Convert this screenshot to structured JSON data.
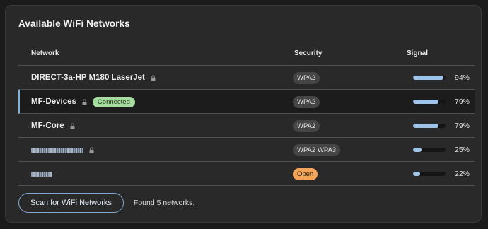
{
  "title": "Available WiFi Networks",
  "columns": {
    "network": "Network",
    "security": "Security",
    "signal": "Signal"
  },
  "networks": [
    {
      "name": "DIRECT-3a-HP M180 LaserJet",
      "locked": true,
      "connected": false,
      "security": [
        "WPA2"
      ],
      "signal_pct": 94,
      "signal_label": "94%"
    },
    {
      "name": "MF-Devices",
      "locked": true,
      "connected": true,
      "connected_label": "Connected",
      "security": [
        "WPA2"
      ],
      "signal_pct": 79,
      "signal_label": "79%"
    },
    {
      "name": "MF-Core",
      "locked": true,
      "connected": false,
      "security": [
        "WPA2"
      ],
      "signal_pct": 79,
      "signal_label": "79%"
    },
    {
      "name": "",
      "redacted": true,
      "locked": true,
      "connected": false,
      "security": [
        "WPA2 WPA3"
      ],
      "signal_pct": 25,
      "signal_label": "25%"
    },
    {
      "name": "",
      "redacted": true,
      "locked": false,
      "connected": false,
      "security": [
        "Open"
      ],
      "signal_pct": 22,
      "signal_label": "22%"
    }
  ],
  "footer": {
    "scan_label": "Scan for WiFi Networks",
    "status": "Found 5 networks."
  },
  "colors": {
    "accent": "#7fb3e0",
    "connected_badge": "#a7dca1",
    "open_badge": "#f2a55a",
    "signal_fill": "#9fc4ea"
  }
}
